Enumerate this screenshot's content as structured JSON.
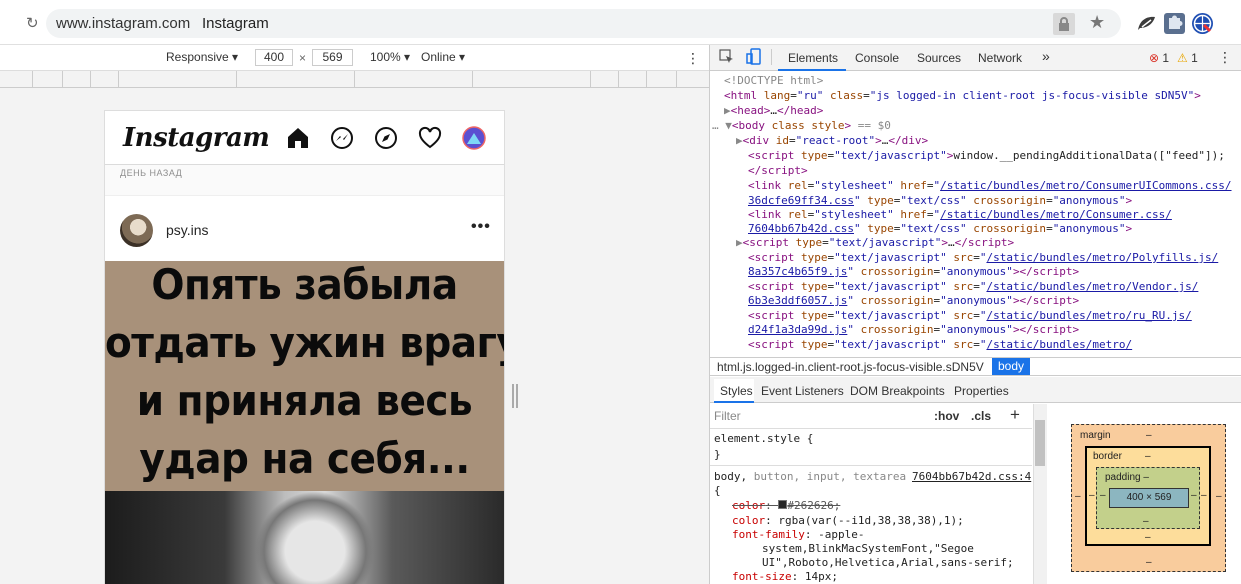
{
  "browser": {
    "url": "www.instagram.com",
    "title": "Instagram",
    "reload_icon": "reload-icon"
  },
  "device_toolbar": {
    "mode": "Responsive",
    "width": "400",
    "times": "×",
    "height": "569",
    "zoom": "100%",
    "network": "Online",
    "more": "⋮"
  },
  "instagram": {
    "logo": "Instagram",
    "day_label": "ДЕНЬ НАЗАД",
    "post": {
      "username": "psy.ins",
      "more": "•••",
      "meme_lines": [
        "Опять забыла",
        "отдать ужин врагу",
        "и приняла весь",
        "удар на себя..."
      ]
    }
  },
  "devtools": {
    "tabs": [
      "Elements",
      "Console",
      "Sources",
      "Network"
    ],
    "more_tabs": "»",
    "errors": "1",
    "warnings": "1",
    "menu": "⋮",
    "breadcrumb": {
      "html": "html.js.logged-in.client-root.js-focus-visible.sDN5V",
      "body": "body"
    },
    "subtabs": [
      "Styles",
      "Event Listeners",
      "DOM Breakpoints",
      "Properties"
    ],
    "filter_placeholder": "Filter",
    "hov": ":hov",
    "cls": ".cls",
    "plus": "+",
    "box_model": {
      "margin": "margin",
      "border": "border",
      "padding": "padding",
      "content": "400 × 569",
      "dash": "–"
    }
  },
  "colors": {
    "accent": "#1a73e8",
    "ig_photo_bg": "#a8917a"
  }
}
